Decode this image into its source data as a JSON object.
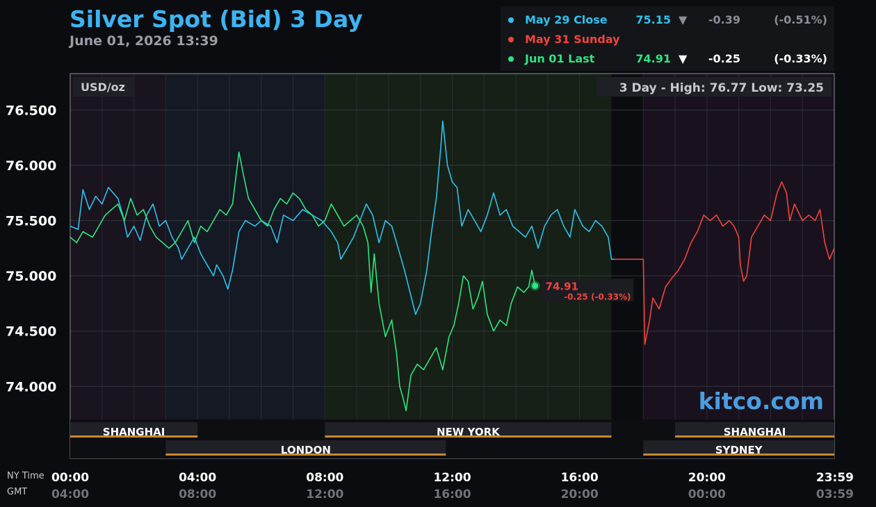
{
  "header": {
    "title": "Silver Spot (Bid) 3 Day",
    "timestamp": "June 01, 2026 13:39"
  },
  "legend": [
    {
      "label": "May 29 Close",
      "value": "75.15",
      "arrow": "▼",
      "change": "-0.39",
      "percent": "(-0.51%)",
      "color": "#2fc1ec",
      "value_color": "#2fc1ec",
      "arrow_color": "#8a8e96",
      "change_color": "#8a8e96"
    },
    {
      "label": "May 31 Sunday",
      "value": "",
      "arrow": "",
      "change": "",
      "percent": "",
      "color": "#f1443c",
      "value_color": "#f1443c",
      "arrow_color": "#ffffff",
      "change_color": "#ffffff"
    },
    {
      "label": "Jun 01 Last",
      "value": "74.91",
      "arrow": "▼",
      "change": "-0.25",
      "percent": "(-0.33%)",
      "color": "#2ee57e",
      "value_color": "#2ee57e",
      "arrow_color": "#ffffff",
      "change_color": "#ffffff"
    }
  ],
  "chart_data": {
    "type": "line",
    "unit_label": "USD/oz",
    "range_note": "3 Day - High: 76.77  Low: 73.25",
    "watermark": "kitco.com",
    "ylim": [
      73.7,
      76.83
    ],
    "xlim": [
      0,
      24
    ],
    "y_ticks": [
      {
        "v": 74.0,
        "label": "74.000"
      },
      {
        "v": 74.5,
        "label": "74.500"
      },
      {
        "v": 75.0,
        "label": "75.000"
      },
      {
        "v": 75.5,
        "label": "75.500"
      },
      {
        "v": 76.0,
        "label": "76.000"
      },
      {
        "v": 76.5,
        "label": "76.500"
      }
    ],
    "x_ticks": [
      {
        "h": 0,
        "ny": "00:00",
        "gmt": "04:00"
      },
      {
        "h": 4,
        "ny": "04:00",
        "gmt": "08:00"
      },
      {
        "h": 8,
        "ny": "08:00",
        "gmt": "12:00"
      },
      {
        "h": 12,
        "ny": "12:00",
        "gmt": "16:00"
      },
      {
        "h": 16,
        "ny": "16:00",
        "gmt": "20:00"
      },
      {
        "h": 20,
        "ny": "20:00",
        "gmt": "00:00"
      },
      {
        "h": 23.98,
        "ny": "23:59",
        "gmt": "03:59"
      }
    ],
    "x_axis_labels": {
      "ny": "NY Time",
      "gmt": "GMT"
    },
    "sessions": [
      {
        "name": "SHANGHAI",
        "start": 0,
        "end": 4,
        "row": 0
      },
      {
        "name": "NEW YORK",
        "start": 8,
        "end": 17,
        "row": 0
      },
      {
        "name": "SHANGHAI",
        "start": 19,
        "end": 24,
        "row": 0
      },
      {
        "name": "LONDON",
        "start": 3,
        "end": 11.8,
        "row": 1
      },
      {
        "name": "SYDNEY",
        "start": 18,
        "end": 24,
        "row": 1
      }
    ],
    "series": [
      {
        "name": "May 29 Close",
        "color": "#2fc1ec",
        "points": [
          [
            0,
            75.45
          ],
          [
            0.25,
            75.42
          ],
          [
            0.4,
            75.78
          ],
          [
            0.6,
            75.6
          ],
          [
            0.8,
            75.72
          ],
          [
            1,
            75.65
          ],
          [
            1.2,
            75.8
          ],
          [
            1.5,
            75.7
          ],
          [
            1.65,
            75.55
          ],
          [
            1.8,
            75.35
          ],
          [
            2,
            75.45
          ],
          [
            2.2,
            75.32
          ],
          [
            2.4,
            75.55
          ],
          [
            2.6,
            75.65
          ],
          [
            2.8,
            75.45
          ],
          [
            3,
            75.5
          ],
          [
            3.2,
            75.35
          ],
          [
            3.4,
            75.25
          ],
          [
            3.5,
            75.15
          ],
          [
            3.7,
            75.25
          ],
          [
            3.9,
            75.35
          ],
          [
            4.1,
            75.2
          ],
          [
            4.3,
            75.1
          ],
          [
            4.5,
            75.0
          ],
          [
            4.6,
            75.1
          ],
          [
            4.8,
            75.0
          ],
          [
            4.95,
            74.88
          ],
          [
            5.1,
            75.05
          ],
          [
            5.3,
            75.4
          ],
          [
            5.5,
            75.5
          ],
          [
            5.8,
            75.45
          ],
          [
            6,
            75.5
          ],
          [
            6.3,
            75.45
          ],
          [
            6.5,
            75.3
          ],
          [
            6.7,
            75.55
          ],
          [
            7,
            75.5
          ],
          [
            7.3,
            75.6
          ],
          [
            7.6,
            75.55
          ],
          [
            7.9,
            75.5
          ],
          [
            8.2,
            75.4
          ],
          [
            8.4,
            75.3
          ],
          [
            8.5,
            75.15
          ],
          [
            8.7,
            75.25
          ],
          [
            8.9,
            75.35
          ],
          [
            9.1,
            75.5
          ],
          [
            9.3,
            75.65
          ],
          [
            9.5,
            75.55
          ],
          [
            9.7,
            75.3
          ],
          [
            9.9,
            75.5
          ],
          [
            10.1,
            75.45
          ],
          [
            10.3,
            75.25
          ],
          [
            10.5,
            75.05
          ],
          [
            10.7,
            74.82
          ],
          [
            10.85,
            74.65
          ],
          [
            11,
            74.75
          ],
          [
            11.2,
            75.05
          ],
          [
            11.35,
            75.4
          ],
          [
            11.5,
            75.7
          ],
          [
            11.65,
            76.2
          ],
          [
            11.7,
            76.4
          ],
          [
            11.85,
            76.0
          ],
          [
            12,
            75.85
          ],
          [
            12.15,
            75.8
          ],
          [
            12.3,
            75.45
          ],
          [
            12.5,
            75.6
          ],
          [
            12.7,
            75.5
          ],
          [
            12.9,
            75.4
          ],
          [
            13.1,
            75.55
          ],
          [
            13.3,
            75.75
          ],
          [
            13.5,
            75.55
          ],
          [
            13.7,
            75.6
          ],
          [
            13.9,
            75.45
          ],
          [
            14.1,
            75.4
          ],
          [
            14.3,
            75.35
          ],
          [
            14.5,
            75.45
          ],
          [
            14.7,
            75.25
          ],
          [
            14.9,
            75.45
          ],
          [
            15.1,
            75.55
          ],
          [
            15.3,
            75.6
          ],
          [
            15.5,
            75.45
          ],
          [
            15.7,
            75.35
          ],
          [
            15.85,
            75.6
          ],
          [
            16.1,
            75.45
          ],
          [
            16.3,
            75.4
          ],
          [
            16.5,
            75.5
          ],
          [
            16.7,
            75.45
          ],
          [
            16.9,
            75.35
          ],
          [
            17,
            75.15
          ],
          [
            17.1,
            75.15
          ]
        ]
      },
      {
        "name": "May 31 Sunday",
        "color": "#f1443c",
        "points": [
          [
            17.1,
            75.15
          ],
          [
            18,
            75.15
          ],
          [
            18.05,
            74.38
          ],
          [
            18.2,
            74.6
          ],
          [
            18.3,
            74.8
          ],
          [
            18.5,
            74.7
          ],
          [
            18.7,
            74.9
          ],
          [
            18.9,
            74.98
          ],
          [
            19.1,
            75.05
          ],
          [
            19.3,
            75.15
          ],
          [
            19.5,
            75.3
          ],
          [
            19.7,
            75.4
          ],
          [
            19.9,
            75.55
          ],
          [
            20.1,
            75.5
          ],
          [
            20.3,
            75.55
          ],
          [
            20.5,
            75.45
          ],
          [
            20.7,
            75.5
          ],
          [
            20.85,
            75.45
          ],
          [
            21,
            75.35
          ],
          [
            21.05,
            75.1
          ],
          [
            21.15,
            74.95
          ],
          [
            21.25,
            75.0
          ],
          [
            21.4,
            75.35
          ],
          [
            21.6,
            75.45
          ],
          [
            21.8,
            75.55
          ],
          [
            22,
            75.5
          ],
          [
            22.2,
            75.75
          ],
          [
            22.35,
            75.85
          ],
          [
            22.5,
            75.75
          ],
          [
            22.6,
            75.5
          ],
          [
            22.75,
            75.65
          ],
          [
            23,
            75.5
          ],
          [
            23.2,
            75.55
          ],
          [
            23.4,
            75.5
          ],
          [
            23.55,
            75.6
          ],
          [
            23.7,
            75.3
          ],
          [
            23.85,
            75.15
          ],
          [
            24,
            75.25
          ]
        ]
      },
      {
        "name": "Jun 01 Last",
        "color": "#2ee57e",
        "points": [
          [
            0,
            75.35
          ],
          [
            0.2,
            75.3
          ],
          [
            0.4,
            75.4
          ],
          [
            0.7,
            75.35
          ],
          [
            0.9,
            75.45
          ],
          [
            1.1,
            75.55
          ],
          [
            1.3,
            75.6
          ],
          [
            1.5,
            75.65
          ],
          [
            1.7,
            75.5
          ],
          [
            1.9,
            75.7
          ],
          [
            2.1,
            75.55
          ],
          [
            2.3,
            75.6
          ],
          [
            2.5,
            75.45
          ],
          [
            2.7,
            75.35
          ],
          [
            2.9,
            75.3
          ],
          [
            3.1,
            75.25
          ],
          [
            3.3,
            75.3
          ],
          [
            3.5,
            75.4
          ],
          [
            3.7,
            75.5
          ],
          [
            3.9,
            75.3
          ],
          [
            4.1,
            75.45
          ],
          [
            4.3,
            75.4
          ],
          [
            4.5,
            75.5
          ],
          [
            4.7,
            75.6
          ],
          [
            4.9,
            75.55
          ],
          [
            5.1,
            75.65
          ],
          [
            5.3,
            76.12
          ],
          [
            5.45,
            75.9
          ],
          [
            5.6,
            75.7
          ],
          [
            5.8,
            75.6
          ],
          [
            6,
            75.5
          ],
          [
            6.2,
            75.45
          ],
          [
            6.4,
            75.6
          ],
          [
            6.6,
            75.7
          ],
          [
            6.8,
            75.65
          ],
          [
            7,
            75.75
          ],
          [
            7.2,
            75.7
          ],
          [
            7.4,
            75.6
          ],
          [
            7.6,
            75.55
          ],
          [
            7.8,
            75.45
          ],
          [
            8,
            75.5
          ],
          [
            8.2,
            75.65
          ],
          [
            8.4,
            75.55
          ],
          [
            8.6,
            75.45
          ],
          [
            8.8,
            75.5
          ],
          [
            9,
            75.55
          ],
          [
            9.2,
            75.45
          ],
          [
            9.35,
            75.3
          ],
          [
            9.45,
            74.85
          ],
          [
            9.55,
            75.2
          ],
          [
            9.7,
            74.75
          ],
          [
            9.9,
            74.45
          ],
          [
            10.1,
            74.6
          ],
          [
            10.25,
            74.3
          ],
          [
            10.35,
            74.0
          ],
          [
            10.45,
            73.9
          ],
          [
            10.55,
            73.78
          ],
          [
            10.7,
            74.1
          ],
          [
            10.9,
            74.2
          ],
          [
            11.1,
            74.15
          ],
          [
            11.3,
            74.25
          ],
          [
            11.5,
            74.35
          ],
          [
            11.7,
            74.15
          ],
          [
            11.9,
            74.45
          ],
          [
            12.05,
            74.55
          ],
          [
            12.2,
            74.75
          ],
          [
            12.35,
            75.0
          ],
          [
            12.5,
            74.95
          ],
          [
            12.65,
            74.7
          ],
          [
            12.8,
            74.8
          ],
          [
            12.95,
            74.95
          ],
          [
            13.1,
            74.65
          ],
          [
            13.3,
            74.5
          ],
          [
            13.5,
            74.6
          ],
          [
            13.7,
            74.55
          ],
          [
            13.85,
            74.75
          ],
          [
            14.05,
            74.9
          ],
          [
            14.25,
            74.85
          ],
          [
            14.4,
            74.9
          ],
          [
            14.5,
            75.05
          ],
          [
            14.6,
            74.91
          ]
        ]
      }
    ],
    "last_point": {
      "h": 14.6,
      "value": "74.91",
      "change": "-0.25 (-0.33%)"
    }
  }
}
